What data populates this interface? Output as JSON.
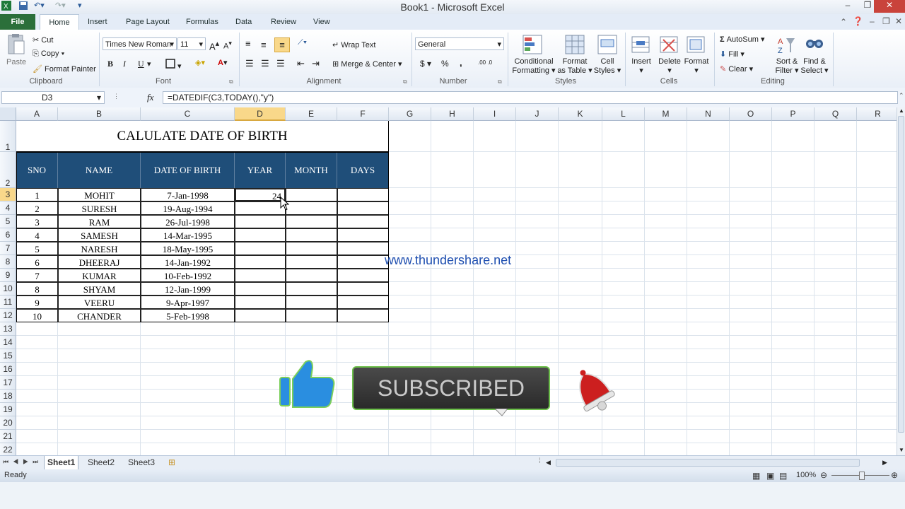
{
  "titlebar": {
    "title": "Book1  -  Microsoft Excel"
  },
  "tabs": {
    "file": "File",
    "items": [
      "Home",
      "Insert",
      "Page Layout",
      "Formulas",
      "Data",
      "Review",
      "View"
    ]
  },
  "ribbon": {
    "clipboard": {
      "paste": "Paste",
      "cut": "Cut",
      "copy": "Copy",
      "format_painter": "Format Painter",
      "label": "Clipboard"
    },
    "font": {
      "name": "Times New Roman",
      "size": "11",
      "bold": "B",
      "italic": "I",
      "underline": "U",
      "label": "Font"
    },
    "alignment": {
      "wrap": "Wrap Text",
      "merge": "Merge & Center",
      "label": "Alignment"
    },
    "number": {
      "format": "General",
      "currency": "$",
      "percent": "%",
      "comma": ",",
      "inc_dec": ".00 .0",
      "label": "Number"
    },
    "styles": {
      "conditional": "Conditional",
      "conditional2": "Formatting",
      "format_table": "Format",
      "format_table2": "as Table",
      "cell_styles": "Cell",
      "cell_styles2": "Styles",
      "label": "Styles"
    },
    "cells": {
      "insert": "Insert",
      "delete": "Delete",
      "format": "Format",
      "label": "Cells"
    },
    "editing": {
      "autosum": "AutoSum",
      "fill": "Fill",
      "clear": "Clear",
      "sort": "Sort &",
      "sort2": "Filter",
      "find": "Find &",
      "find2": "Select",
      "label": "Editing"
    }
  },
  "formula_bar": {
    "name_box": "D3",
    "fx": "fx",
    "formula": "=DATEDIF(C3,TODAY(),\"y\")"
  },
  "columns": [
    "A",
    "B",
    "C",
    "D",
    "E",
    "F",
    "G",
    "H",
    "I",
    "J",
    "K",
    "L",
    "M",
    "N",
    "O",
    "P",
    "Q",
    "R"
  ],
  "rows": [
    "1",
    "2",
    "3",
    "4",
    "5",
    "6",
    "7",
    "8",
    "9",
    "10",
    "11",
    "12",
    "13",
    "14",
    "15",
    "16",
    "17",
    "18",
    "19",
    "20",
    "21",
    "22"
  ],
  "sheet": {
    "title": "CALULATE  DATE OF BIRTH",
    "headers": [
      "SNO",
      "NAME",
      "DATE OF BIRTH",
      "YEAR",
      "MONTH",
      "DAYS"
    ],
    "data": [
      [
        "1",
        "MOHIT",
        "7-Jan-1998",
        "24",
        "",
        ""
      ],
      [
        "2",
        "SURESH",
        "19-Aug-1994",
        "",
        "",
        ""
      ],
      [
        "3",
        "RAM",
        "26-Jul-1998",
        "",
        "",
        ""
      ],
      [
        "4",
        "SAMESH",
        "14-Mar-1995",
        "",
        "",
        ""
      ],
      [
        "5",
        "NARESH",
        "18-May-1995",
        "",
        "",
        ""
      ],
      [
        "6",
        "DHEERAJ",
        "14-Jan-1992",
        "",
        "",
        ""
      ],
      [
        "7",
        "KUMAR",
        "10-Feb-1992",
        "",
        "",
        ""
      ],
      [
        "8",
        "SHYAM",
        "12-Jan-1999",
        "",
        "",
        ""
      ],
      [
        "9",
        "VEERU",
        "9-Apr-1997",
        "",
        "",
        ""
      ],
      [
        "10",
        "CHANDER",
        "5-Feb-1998",
        "",
        "",
        ""
      ]
    ]
  },
  "overlay": {
    "website": "www.thundershare.net",
    "subscribe": "SUBSCRIBED"
  },
  "sheet_tabs": [
    "Sheet1",
    "Sheet2",
    "Sheet3"
  ],
  "status": {
    "ready": "Ready",
    "zoom": "100%"
  },
  "colors": {
    "header_fill": "#1f4e79",
    "file_tab": "#2b6f3a",
    "website": "#1f4fb0",
    "selected_col": "#f9d88a"
  }
}
